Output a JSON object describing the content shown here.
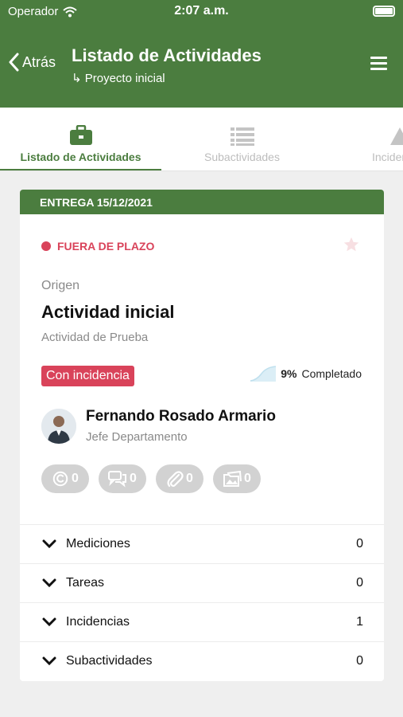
{
  "status_bar": {
    "carrier": "Operador",
    "time": "2:07 a.m."
  },
  "header": {
    "back_label": "Atrás",
    "title": "Listado de Actividades",
    "subtitle": "↳ Proyecto inicial"
  },
  "tabs": [
    {
      "label": "Listado de Actividades",
      "active": true
    },
    {
      "label": "Subactividades",
      "active": false
    },
    {
      "label": "Incidencias",
      "active": false
    }
  ],
  "card": {
    "header": "ENTREGA 15/12/2021",
    "status": "FUERA DE PLAZO",
    "origin_label": "Origen",
    "title": "Actividad inicial",
    "description": "Actividad de Prueba",
    "badge": "Con incidencia",
    "progress": {
      "percent": "9%",
      "label": "Completado"
    },
    "person": {
      "name": "Fernando Rosado Armario",
      "role": "Jefe Departamento"
    },
    "counters": [
      {
        "icon": "at-icon",
        "value": "0"
      },
      {
        "icon": "comments-icon",
        "value": "0"
      },
      {
        "icon": "paperclip-icon",
        "value": "0"
      },
      {
        "icon": "folder-image-icon",
        "value": "0"
      }
    ],
    "sections": [
      {
        "label": "Mediciones",
        "count": "0"
      },
      {
        "label": "Tareas",
        "count": "0"
      },
      {
        "label": "Incidencias",
        "count": "1"
      },
      {
        "label": "Subactividades",
        "count": "0"
      }
    ]
  },
  "colors": {
    "primary": "#4b7d3f",
    "alert": "#d9435a",
    "muted": "#8a8a8a",
    "chip": "#d2d2d2"
  }
}
